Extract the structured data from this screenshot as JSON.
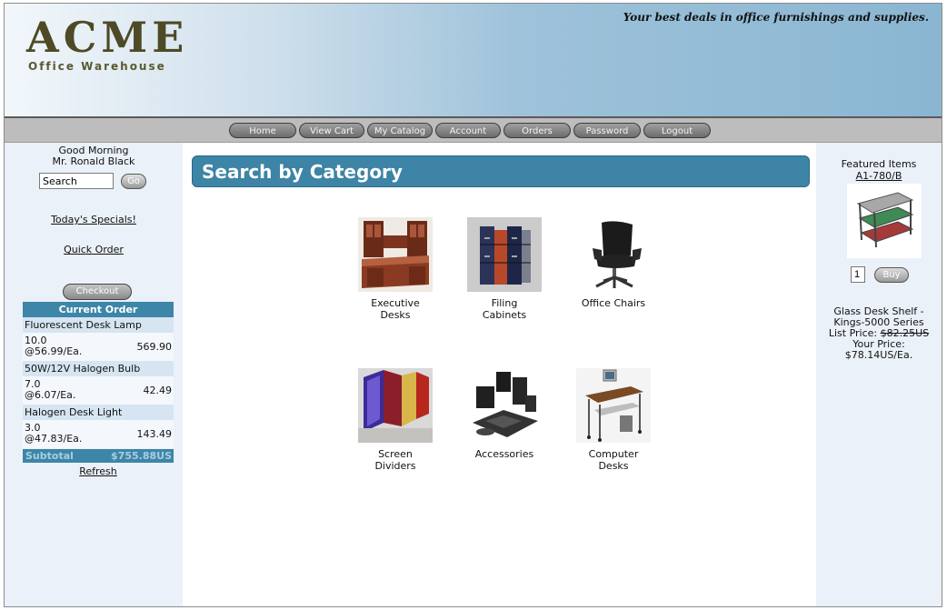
{
  "header": {
    "logo_main": "ACME",
    "logo_sub": "Office Warehouse",
    "tagline": "Your best deals in office furnishings and supplies."
  },
  "nav": {
    "items": [
      "Home",
      "View Cart",
      "My Catalog",
      "Account",
      "Orders",
      "Password",
      "Logout"
    ]
  },
  "sidebar": {
    "greeting_line1": "Good Morning",
    "greeting_line2": "Mr. Ronald Black",
    "search_value": "Search",
    "go_label": "Go",
    "specials_link": "Today's Specials!",
    "quick_order_link": "Quick Order",
    "checkout_label": "Checkout",
    "current_order": {
      "heading": "Current Order",
      "items": [
        {
          "name": "Fluorescent Desk Lamp",
          "qty": "10.0",
          "price": "@56.99/Ea.",
          "amount": "569.90"
        },
        {
          "name": "50W/12V Halogen Bulb",
          "qty": "7.0",
          "price": "@6.07/Ea.",
          "amount": "42.49"
        },
        {
          "name": "Halogen Desk Light",
          "qty": "3.0",
          "price": "@47.83/Ea.",
          "amount": "143.49"
        }
      ],
      "subtotal_label": "Subtotal",
      "subtotal_value": "$755.88US",
      "refresh_link": "Refresh"
    }
  },
  "main": {
    "title": "Search by Category",
    "categories": [
      {
        "line1": "Executive",
        "line2": "Desks"
      },
      {
        "line1": "Filing",
        "line2": "Cabinets"
      },
      {
        "line1": "Office Chairs",
        "line2": ""
      },
      {
        "line1": "Screen",
        "line2": "Dividers"
      },
      {
        "line1": "Accessories",
        "line2": ""
      },
      {
        "line1": "Computer",
        "line2": "Desks"
      }
    ]
  },
  "featured": {
    "heading": "Featured Items",
    "item_code": "A1-780/B",
    "qty_value": "1",
    "buy_label": "Buy",
    "desc_line1": "Glass Desk Shelf -",
    "desc_line2": "Kings-5000 Series",
    "list_price_label": "List Price:",
    "list_price": "$82.25US",
    "your_price_label": "Your Price:",
    "your_price": "$78.14US/Ea."
  }
}
